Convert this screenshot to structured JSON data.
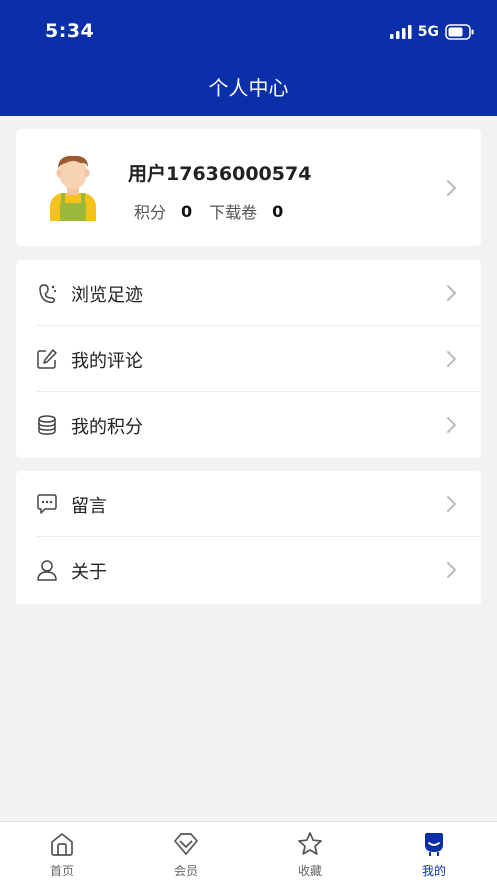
{
  "status_bar": {
    "time": "5:34",
    "network": "5G"
  },
  "header": {
    "title": "个人中心"
  },
  "profile": {
    "username": "用户17636000574",
    "points_label": "积分",
    "points_value": "0",
    "vouchers_label": "下载卷",
    "vouchers_value": "0"
  },
  "menu_group_1": [
    {
      "label": "浏览足迹",
      "icon": "footprint-icon"
    },
    {
      "label": "我的评论",
      "icon": "edit-icon"
    },
    {
      "label": "我的积分",
      "icon": "coins-icon"
    }
  ],
  "menu_group_2": [
    {
      "label": "留言",
      "icon": "message-icon"
    },
    {
      "label": "关于",
      "icon": "user-icon"
    }
  ],
  "tabbar": {
    "items": [
      {
        "label": "首页",
        "icon": "home-icon"
      },
      {
        "label": "会员",
        "icon": "diamond-icon"
      },
      {
        "label": "收藏",
        "icon": "star-icon"
      },
      {
        "label": "我的",
        "icon": "profile-icon"
      }
    ],
    "active_index": 3
  },
  "colors": {
    "brand": "#0a2fa8",
    "background": "#f2f2f4"
  }
}
